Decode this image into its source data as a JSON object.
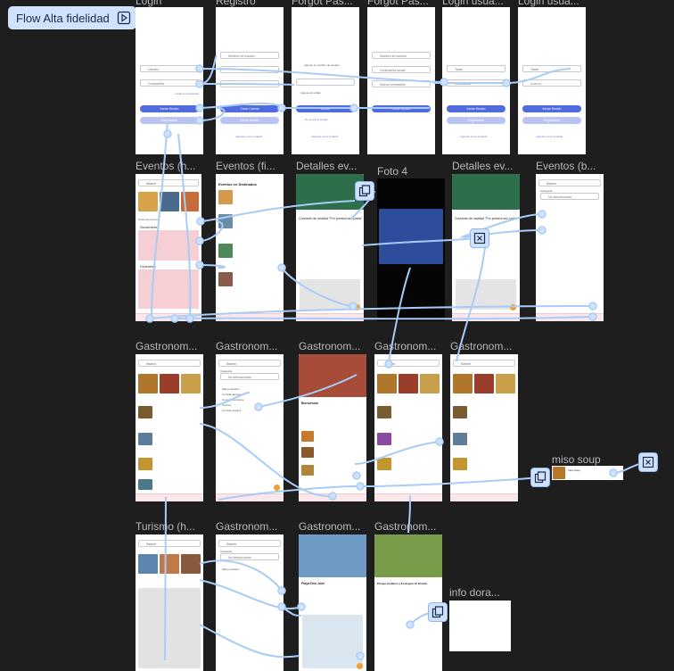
{
  "flow": {
    "label": "Flow Alta fidelidad",
    "icon": "flow-play-icon"
  },
  "colors": {
    "canvas": "#1e1e1e",
    "connector": "#a8ccf7",
    "primary_button": "#4f6bde",
    "accent_pink": "#f6cfd5"
  },
  "frames": {
    "login": "Login",
    "registro": "Registro",
    "forgot": "Forgot Pas...",
    "forgot2": "Forgot Pas...",
    "login_usu1": "Login usua...",
    "login_usu2": "Login usua...",
    "eventos_h": "Eventos (h...",
    "eventos_fi": "Eventos (fi...",
    "detalles1": "Detalles ev...",
    "foto4": "Foto 4",
    "detalles2": "Detalles ev...",
    "eventos_b": "Eventos (b...",
    "gastro1": "Gastronom...",
    "gastro2": "Gastronom...",
    "gastro3": "Gastronom...",
    "gastro4": "Gastronom...",
    "gastro5": "Gastronom...",
    "miso": "miso soup",
    "turismo": "Turismo (h...",
    "gastro6": "Gastronom...",
    "gastro7": "Gastronom...",
    "gastro8": "Gastronom...",
    "info": "info dora..."
  },
  "login_screen": {
    "user": "Usuario",
    "password": "Contraseña",
    "login_btn": "Iniciar Sesión",
    "register_btn": "Registrarse",
    "forgot_link": "olvidé la contraseña"
  },
  "registro_screen": {
    "user": "Nombre de usuario",
    "create_btn": "Crear Cuenta",
    "login_btn": "Iniciar Sesión",
    "link": "Ingresar como invitado"
  },
  "forgot_screen": {
    "hint": "Ingrese su nombre de usuario",
    "code": "Ingrese el código",
    "send_btn": "Enviar",
    "resend": "Re-enviar el código"
  },
  "forgot2_screen": {
    "user": "Nombre de usuario",
    "current": "Contraseña actual",
    "new": "Nueva contraseña",
    "btn": "Iniciar Sesión"
  },
  "usu1_screen": {
    "user": "Tester",
    "password": "Contraseña",
    "btn": "Iniciar Sesión",
    "btn2": "Registrarse",
    "link": "Ingresar como invitado"
  },
  "usu2_screen": {
    "user": "Tester",
    "password": "••••••••••",
    "btn": "Iniciar Sesión",
    "btn2": "Registrarse",
    "link": "Ingresar como invitado"
  },
  "eventos": {
    "search": "Search",
    "months": [
      "Noviembre",
      "Diciembre"
    ],
    "title": "Todos los eventos",
    "list_title": "Eventos en Distinados",
    "categoria": "Categoría",
    "placeholder": "No seleccionado"
  },
  "detalle": {
    "title": "Concierto de navidad \"Por primera vez juntos\""
  },
  "gastro": {
    "search": "Search",
    "categoria": "Categoría",
    "placeholder": "No seleccionado",
    "options": [
      "Más populares",
      "Comida japonesa",
      "Comida mexicana",
      "Postres",
      "Comida vegana"
    ],
    "place": "Bienvenido"
  },
  "miso": {
    "name": "miso soup"
  },
  "turismo": {
    "search": "Search",
    "title": "Playa Don José",
    "subtitle": "Parque Acuático y Ecológico El Dorado"
  }
}
